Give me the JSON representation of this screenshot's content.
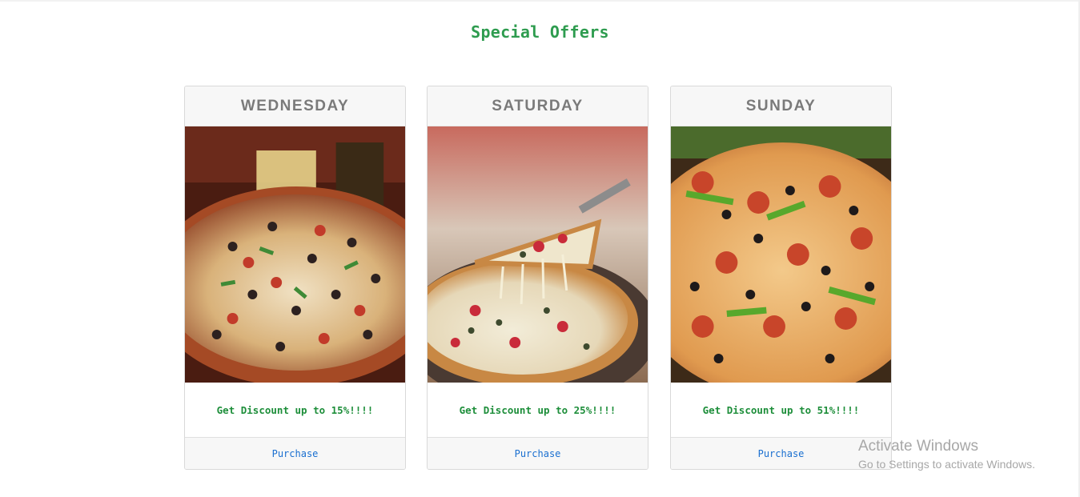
{
  "page": {
    "title": "Special Offers"
  },
  "offers": [
    {
      "day": "WEDNESDAY",
      "image": "pizza-photo-wednesday",
      "discount": "Get Discount up to 15%!!!!",
      "action": "Purchase"
    },
    {
      "day": "SATURDAY",
      "image": "pizza-photo-saturday",
      "discount": "Get Discount up to 25%!!!!",
      "action": "Purchase"
    },
    {
      "day": "SUNDAY",
      "image": "pizza-photo-sunday",
      "discount": "Get Discount up to 51%!!!!",
      "action": "Purchase"
    }
  ],
  "watermark": {
    "title": "Activate Windows",
    "subtitle": "Go to Settings to activate Windows."
  },
  "colors": {
    "title_green": "#2e9c4f",
    "discount_green": "#1d8e3a",
    "link_blue": "#1a6fd0",
    "header_gray": "#7a7a7a"
  }
}
